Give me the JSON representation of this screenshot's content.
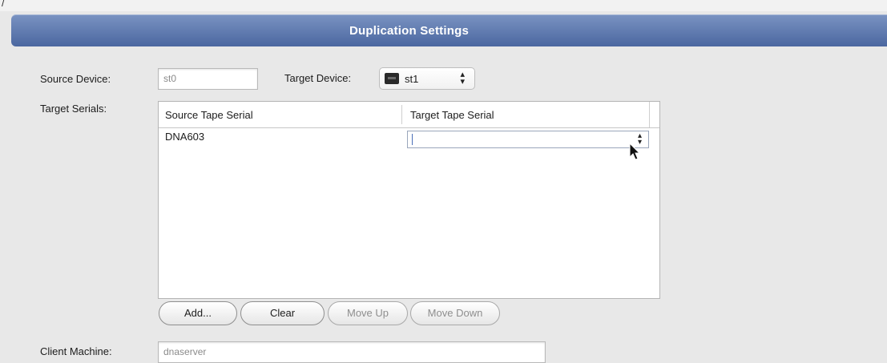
{
  "top_fragment": "/",
  "header": {
    "title": "Duplication Settings"
  },
  "source_device": {
    "label": "Source Device:",
    "value": "st0"
  },
  "target_device": {
    "label": "Target Device:",
    "value": "st1",
    "icon": "tape-drive-icon"
  },
  "target_serials": {
    "label": "Target Serials:",
    "columns": [
      "Source Tape Serial",
      "Target Tape Serial"
    ],
    "rows": [
      {
        "source": "DNA603",
        "target": ""
      }
    ]
  },
  "buttons": {
    "add": "Add...",
    "clear": "Clear",
    "move_up": "Move Up",
    "move_down": "Move Down"
  },
  "client_machine": {
    "label": "Client Machine:",
    "value": "dnaserver"
  },
  "colors": {
    "banner": "#5a74aa",
    "background": "#e8e8e8"
  }
}
